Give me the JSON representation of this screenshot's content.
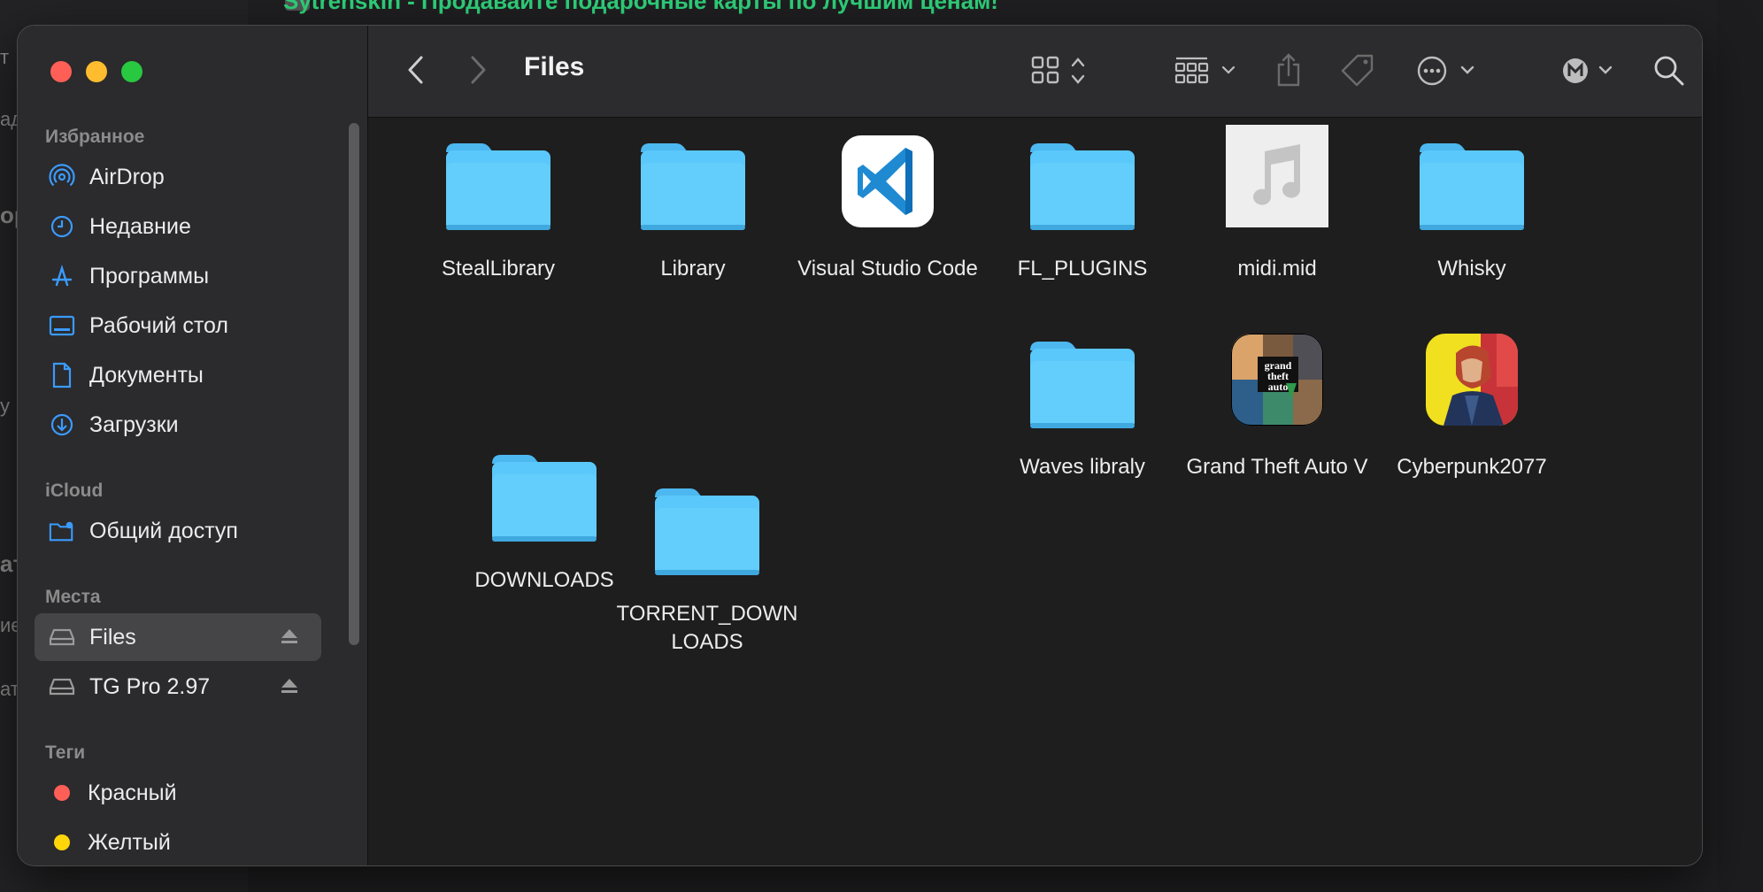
{
  "background": {
    "banner_text": "Sytrenskin - Продавайте подарочные карты по лучшим ценам!",
    "left_fragments": [
      "т",
      "ад",
      "ор",
      "у",
      "ат",
      "ие",
      "ат"
    ]
  },
  "window": {
    "title": "Files"
  },
  "sidebar": {
    "favorites_title": "Избранное",
    "favorites": [
      {
        "label": "AirDrop",
        "icon": "airdrop-icon"
      },
      {
        "label": "Недавние",
        "icon": "clock-icon"
      },
      {
        "label": "Программы",
        "icon": "applications-icon"
      },
      {
        "label": "Рабочий стол",
        "icon": "desktop-icon"
      },
      {
        "label": "Документы",
        "icon": "document-icon"
      },
      {
        "label": "Загрузки",
        "icon": "download-icon"
      }
    ],
    "icloud_title": "iCloud",
    "icloud": [
      {
        "label": "Общий доступ",
        "icon": "shared-folder-icon"
      }
    ],
    "locations_title": "Места",
    "locations": [
      {
        "label": "Files",
        "icon": "drive-icon",
        "selected": true
      },
      {
        "label": "TG Pro 2.97",
        "icon": "drive-icon",
        "selected": false
      }
    ],
    "tags_title": "Теги",
    "tags": [
      {
        "label": "Красный",
        "color": "#ff5f57"
      },
      {
        "label": "Желтый",
        "color": "#ffd60a"
      }
    ]
  },
  "toolbar": {
    "icons": [
      "back-icon",
      "forward-icon",
      "grid-view-icon",
      "group-icon",
      "share-icon",
      "tag-icon",
      "more-icon",
      "mega-account-icon",
      "search-icon"
    ]
  },
  "files": [
    {
      "name": "StealLibrary",
      "kind": "folder"
    },
    {
      "name": "Library",
      "kind": "folder"
    },
    {
      "name": "Visual Studio Code",
      "kind": "app-vscode"
    },
    {
      "name": "FL_PLUGINS",
      "kind": "folder"
    },
    {
      "name": "midi.mid",
      "kind": "audio-file"
    },
    {
      "name": "Whisky",
      "kind": "folder"
    },
    {
      "name": "Waves libraly",
      "kind": "folder"
    },
    {
      "name": "Grand Theft Auto V",
      "kind": "app-gta"
    },
    {
      "name": "Cyberpunk2077",
      "kind": "app-cyberpunk"
    },
    {
      "name": "DOWNLOADS",
      "kind": "folder"
    },
    {
      "name": "TORRENT_DOWNLOADS",
      "kind": "folder"
    }
  ],
  "colors": {
    "folder": "#5ac8fa",
    "accent": "#0a84ff"
  }
}
